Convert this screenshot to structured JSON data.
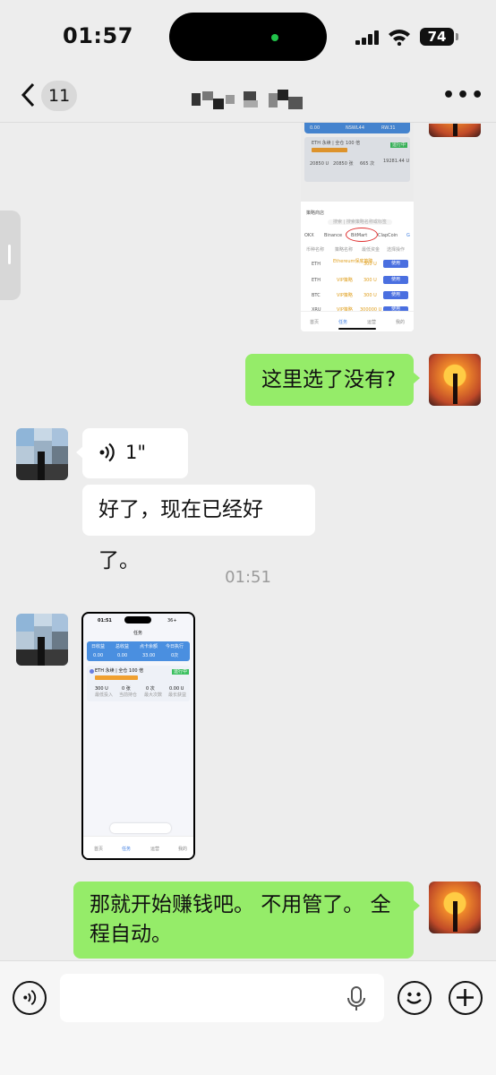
{
  "status_bar": {
    "time": "01:57",
    "battery": "74"
  },
  "nav": {
    "unread_count": "11",
    "more_label": "•••"
  },
  "messages": {
    "m1_text": "这里选了没有?",
    "voice_duration": "1\"",
    "m2_text": "好了，现在已经好了。",
    "timestamp": "01:51",
    "m3_text": "那就开始赚钱吧。 不用管了。 全程自动。"
  },
  "shot1": {
    "stats": [
      "0.00",
      "NSWL44",
      "RW.31"
    ],
    "item_title": "ETH 永续 | 全仓 100 倍",
    "item_tag": "运行中",
    "item_vals": [
      "20850 U",
      "20850 张",
      "665 次",
      "19281.44 U"
    ],
    "section_label": "策略商店",
    "search_placeholder": "搜索 | 搜索策略名称或标签",
    "exchanges": [
      "OKX",
      "Binance",
      "BitMart",
      "ClapCoin",
      "G"
    ],
    "table_headers": [
      "币种名称",
      "策略名称",
      "最低资金",
      "选择操作"
    ],
    "rows": [
      {
        "coin": "ETH",
        "strategy": "Ethereum保底策略",
        "min": "300 U",
        "action": "使用"
      },
      {
        "coin": "ETH",
        "strategy": "VIP策略",
        "min": "300 U",
        "action": "使用"
      },
      {
        "coin": "BTC",
        "strategy": "VIP策略",
        "min": "300 U",
        "action": "使用"
      },
      {
        "coin": "XRU",
        "strategy": "VIP策略",
        "min": "300000 U",
        "action": "使用"
      }
    ],
    "tabs": [
      "首页",
      "任务",
      "运营",
      "我的"
    ]
  },
  "shot2": {
    "time": "01:51",
    "signal": "36+",
    "header": "任务",
    "stat_labels": [
      "日收益",
      "总收益",
      "点卡余额",
      "今日执行"
    ],
    "stat_values": [
      "0.00",
      "0.00",
      "33.00",
      "0次"
    ],
    "item_title": "ETH 永续 | 全仓 100 倍",
    "item_tag": "运行中",
    "item_vals": [
      "300 U",
      "0 张",
      "0 次",
      "0.00 U"
    ],
    "item_labels": [
      "最低投入",
      "当前持仓",
      "最大次数",
      "最长获益"
    ],
    "tabs": [
      "首页",
      "任务",
      "运营",
      "我的"
    ]
  },
  "colors": {
    "green_bubble": "#95ec69",
    "background": "#ededed",
    "blue_header": "#4a8fe0"
  }
}
